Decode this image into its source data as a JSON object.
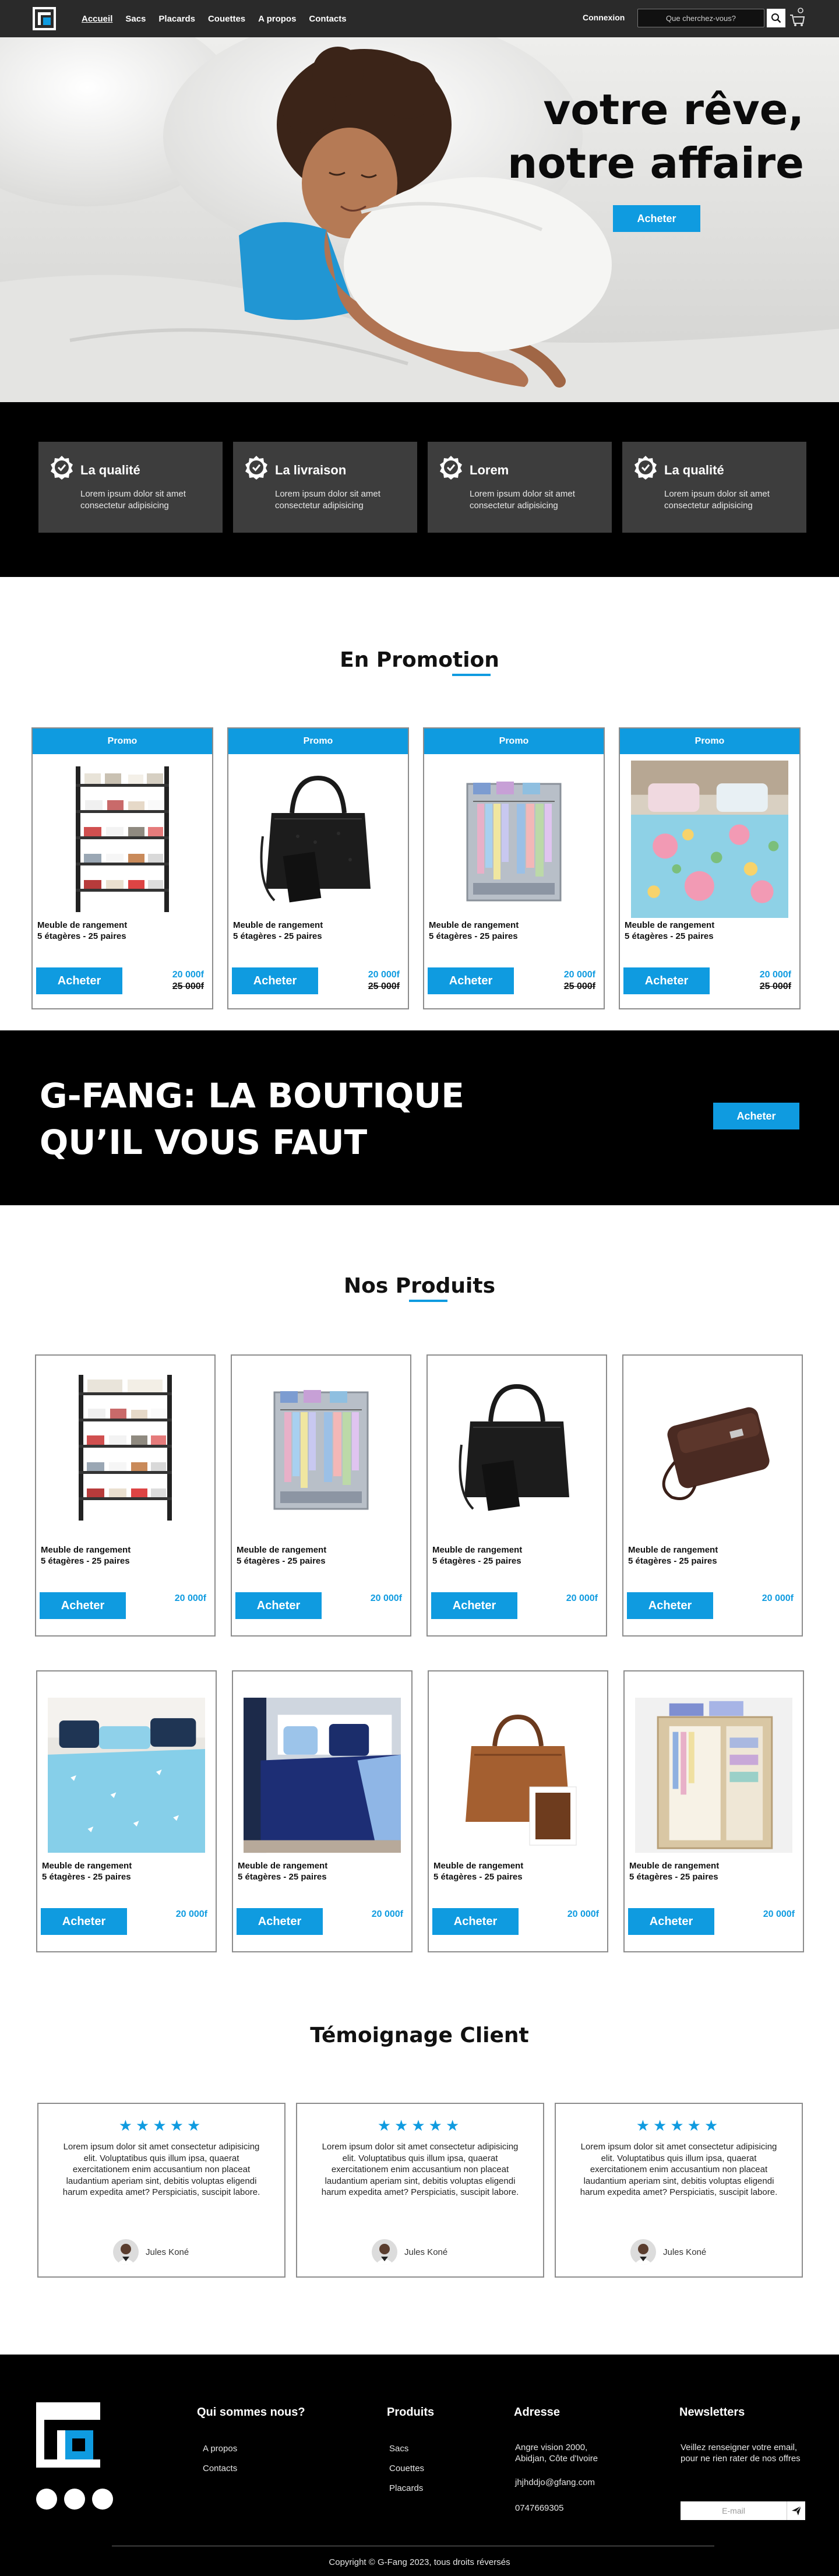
{
  "nav": {
    "links": [
      "Accueil",
      "Sacs",
      "Placards",
      "Couettes",
      "A propos",
      "Contacts"
    ],
    "connexion": "Connexion",
    "search_placeholder": "Que cherchez-vous?",
    "logo_icon": "g-fang-logo-icon",
    "search_icon": "search-icon",
    "cart_icon": "shopping-cart-icon"
  },
  "hero": {
    "title_line1": "votre rêve,",
    "title_line2": "notre affaire",
    "button": "Acheter"
  },
  "features": [
    {
      "title": "La qualité",
      "text": "Lorem ipsum dolor sit amet consectetur adipisicing",
      "icon": "badge-check-icon"
    },
    {
      "title": "La livraison",
      "text": "Lorem ipsum dolor sit amet consectetur adipisicing",
      "icon": "badge-check-icon"
    },
    {
      "title": "Lorem",
      "text": "Lorem ipsum dolor sit amet consectetur adipisicing",
      "icon": "badge-check-icon"
    },
    {
      "title": "La qualité",
      "text": "Lorem ipsum dolor sit amet consectetur adipisicing",
      "icon": "badge-check-icon"
    }
  ],
  "promotion": {
    "title": "En Promotion",
    "items": [
      {
        "badge": "Promo",
        "name_line1": "Meuble de rangement",
        "name_line2": "5 étagères - 25 paires",
        "button": "Acheter",
        "price": "20 000f",
        "old_price": "25 000f",
        "image": "shoe-rack-image"
      },
      {
        "badge": "Promo",
        "name_line1": "Meuble de rangement",
        "name_line2": "5 étagères - 25 paires",
        "button": "Acheter",
        "price": "20 000f",
        "old_price": "25 000f",
        "image": "black-handbag-image"
      },
      {
        "badge": "Promo",
        "name_line1": "Meuble de rangement",
        "name_line2": "5 étagères - 25 paires",
        "button": "Acheter",
        "price": "20 000f",
        "old_price": "25 000f",
        "image": "fabric-wardrobe-image"
      },
      {
        "badge": "Promo",
        "name_line1": "Meuble de rangement",
        "name_line2": "5 étagères - 25 paires",
        "button": "Acheter",
        "price": "20 000f",
        "old_price": "25 000f",
        "image": "floral-duvet-image"
      }
    ]
  },
  "banner": {
    "line1": "G-FANG: LA BOUTIQUE",
    "line2": "QU’IL VOUS FAUT",
    "button": "Acheter"
  },
  "products": {
    "title": "Nos Produits",
    "items": [
      {
        "name_line1": "Meuble de rangement",
        "name_line2": "5 étagères - 25 paires",
        "button": "Acheter",
        "price": "20 000f",
        "image": "shoe-rack-image"
      },
      {
        "name_line1": "Meuble de rangement",
        "name_line2": "5 étagères - 25 paires",
        "button": "Acheter",
        "price": "20 000f",
        "image": "fabric-wardrobe-image"
      },
      {
        "name_line1": "Meuble de rangement",
        "name_line2": "5 étagères - 25 paires",
        "button": "Acheter",
        "price": "20 000f",
        "image": "black-handbag-image"
      },
      {
        "name_line1": "Meuble de rangement",
        "name_line2": "5 étagères - 25 paires",
        "button": "Acheter",
        "price": "20 000f",
        "image": "brown-clutch-image"
      },
      {
        "name_line1": "Meuble de rangement",
        "name_line2": "5 étagères - 25 paires",
        "button": "Acheter",
        "price": "20 000f",
        "image": "blue-duvet-image"
      },
      {
        "name_line1": "Meuble de rangement",
        "name_line2": "5 étagères - 25 paires",
        "button": "Acheter",
        "price": "20 000f",
        "image": "navy-duvet-image"
      },
      {
        "name_line1": "Meuble de rangement",
        "name_line2": "5 étagères - 25 paires",
        "button": "Acheter",
        "price": "20 000f",
        "image": "brown-leather-bag-image"
      },
      {
        "name_line1": "Meuble de rangement",
        "name_line2": "5 étagères - 25 paires",
        "button": "Acheter",
        "price": "20 000f",
        "image": "beige-wardrobe-image"
      }
    ]
  },
  "testimonials": {
    "title": "Témoignage Client",
    "items": [
      {
        "stars": "★★★★★",
        "rating": 5,
        "text": "Lorem ipsum dolor sit amet consectetur adipisicing elit. Voluptatibus quis illum ipsa, quaerat exercitationem enim accusantium non placeat laudantium aperiam sint, debitis voluptas eligendi harum expedita amet? Perspiciatis, suscipit labore.",
        "author": "Jules Koné"
      },
      {
        "stars": "★★★★★",
        "rating": 5,
        "text": "Lorem ipsum dolor sit amet consectetur adipisicing elit. Voluptatibus quis illum ipsa, quaerat exercitationem enim accusantium non placeat laudantium aperiam sint, debitis voluptas eligendi harum expedita amet? Perspiciatis, suscipit labore.",
        "author": "Jules Koné"
      },
      {
        "stars": "★★★★★",
        "rating": 5,
        "text": "Lorem ipsum dolor sit amet consectetur adipisicing elit. Voluptatibus quis illum ipsa, quaerat exercitationem enim accusantium non placeat laudantium aperiam sint, debitis voluptas eligendi harum expedita amet? Perspiciatis, suscipit labore.",
        "author": "Jules Koné"
      }
    ]
  },
  "footer": {
    "about_title": "Qui sommes nous?",
    "about_links": [
      "A propos",
      "Contacts"
    ],
    "products_title": "Produits",
    "products_links": [
      "Sacs",
      "Couettes",
      "Placards"
    ],
    "address_title": "Adresse",
    "address_line1": "Angre vision 2000,",
    "address_line2": "Abidjan, Côte d'Ivoire",
    "email": "jhjhddjo@gfang.com",
    "phone": "0747669305",
    "newsletter_title": "Newsletters",
    "newsletter_text": "Veillez renseigner votre email, pour ne rien rater de nos offres",
    "email_placeholder": "E-mail",
    "copyright": "Copyright  © G-Fang 2023, tous droits réversés"
  },
  "colors": {
    "accent": "#0f9be0",
    "navbar": "#2a2a2a",
    "dark": "#000000",
    "feature_card": "#3d3d3d"
  }
}
